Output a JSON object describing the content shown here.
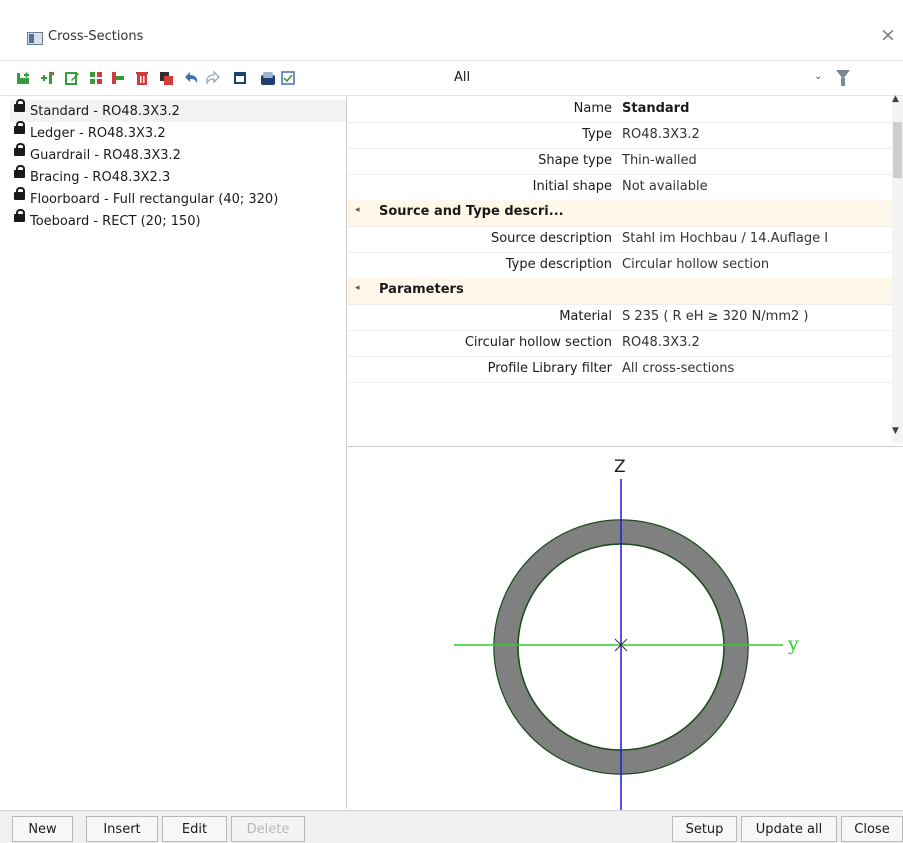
{
  "window": {
    "title": "Cross-Sections",
    "close_glyph": "×"
  },
  "toolbar": {
    "icons": [
      "new-item-icon",
      "insert-item-icon",
      "edit-icon",
      "library-icon",
      "copy-icon",
      "delete-icon",
      "duplicate-icon",
      "undo-icon",
      "redo-icon",
      "table-icon",
      "export-icon",
      "checklist-icon"
    ],
    "filter_value": "All",
    "filter_chevron": "⌄"
  },
  "list": {
    "items": [
      {
        "label": "Standard - RO48.3X3.2",
        "selected": true
      },
      {
        "label": "Ledger - RO48.3X3.2"
      },
      {
        "label": "Guardrail - RO48.3X3.2"
      },
      {
        "label": "Bracing - RO48.3X2.3"
      },
      {
        "label": "Floorboard - Full rectangular (40; 320)"
      },
      {
        "label": "Toeboard - RECT (20; 150)"
      }
    ]
  },
  "properties": {
    "name_label": "Name",
    "name_value": "Standard",
    "type_label": "Type",
    "type_value": "RO48.3X3.2",
    "shape_type_label": "Shape type",
    "shape_type_value": "Thin-walled",
    "initial_shape_label": "Initial shape",
    "initial_shape_value": "Not available",
    "section1_title": "Source and Type descri...",
    "source_desc_label": "Source description",
    "source_desc_value": "Stahl im Hochbau / 14.Auflage I",
    "type_desc_label": "Type description",
    "type_desc_value": "Circular hollow section",
    "section2_title": "Parameters",
    "material_label": "Material",
    "material_value": "S 235 ( R eH ≥ 320 N/mm2 )",
    "chs_label": "Circular hollow section",
    "chs_value": "RO48.3X3.2",
    "filter_label": "Profile Library filter",
    "filter_value": "All cross-sections",
    "collapse_glyph": "◂"
  },
  "preview": {
    "z_axis_label": "Z",
    "y_axis_label": "y",
    "ring_color": "#808080",
    "z_axis_color": "#1a1adf",
    "y_axis_color": "#2ad12a"
  },
  "buttons": {
    "new": "New",
    "insert": "Insert",
    "edit": "Edit",
    "delete": "Delete",
    "setup": "Setup",
    "update_all": "Update all",
    "close": "Close"
  }
}
